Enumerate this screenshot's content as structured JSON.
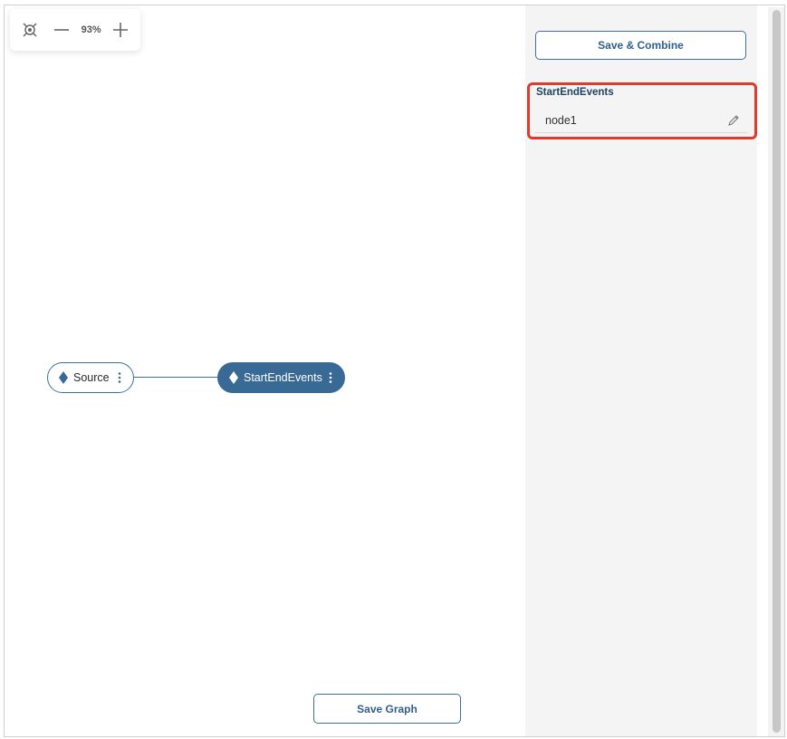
{
  "canvas": {
    "zoom": {
      "fit_icon": "fit-to-screen-icon",
      "zoom_out_icon": "minus-icon",
      "level": "93%",
      "zoom_in_icon": "plus-icon"
    },
    "nodes": [
      {
        "label": "Source",
        "selected": false
      },
      {
        "label": "StartEndEvents",
        "selected": true
      }
    ],
    "save_graph_label": "Save Graph"
  },
  "panel": {
    "save_combine_label": "Save & Combine",
    "section_title": "StartEndEvents",
    "node_name": "node1",
    "edit_icon": "pencil-icon"
  },
  "colors": {
    "accent": "#396a96",
    "highlight": "#e03a2f",
    "panel_bg": "#f4f4f4"
  }
}
